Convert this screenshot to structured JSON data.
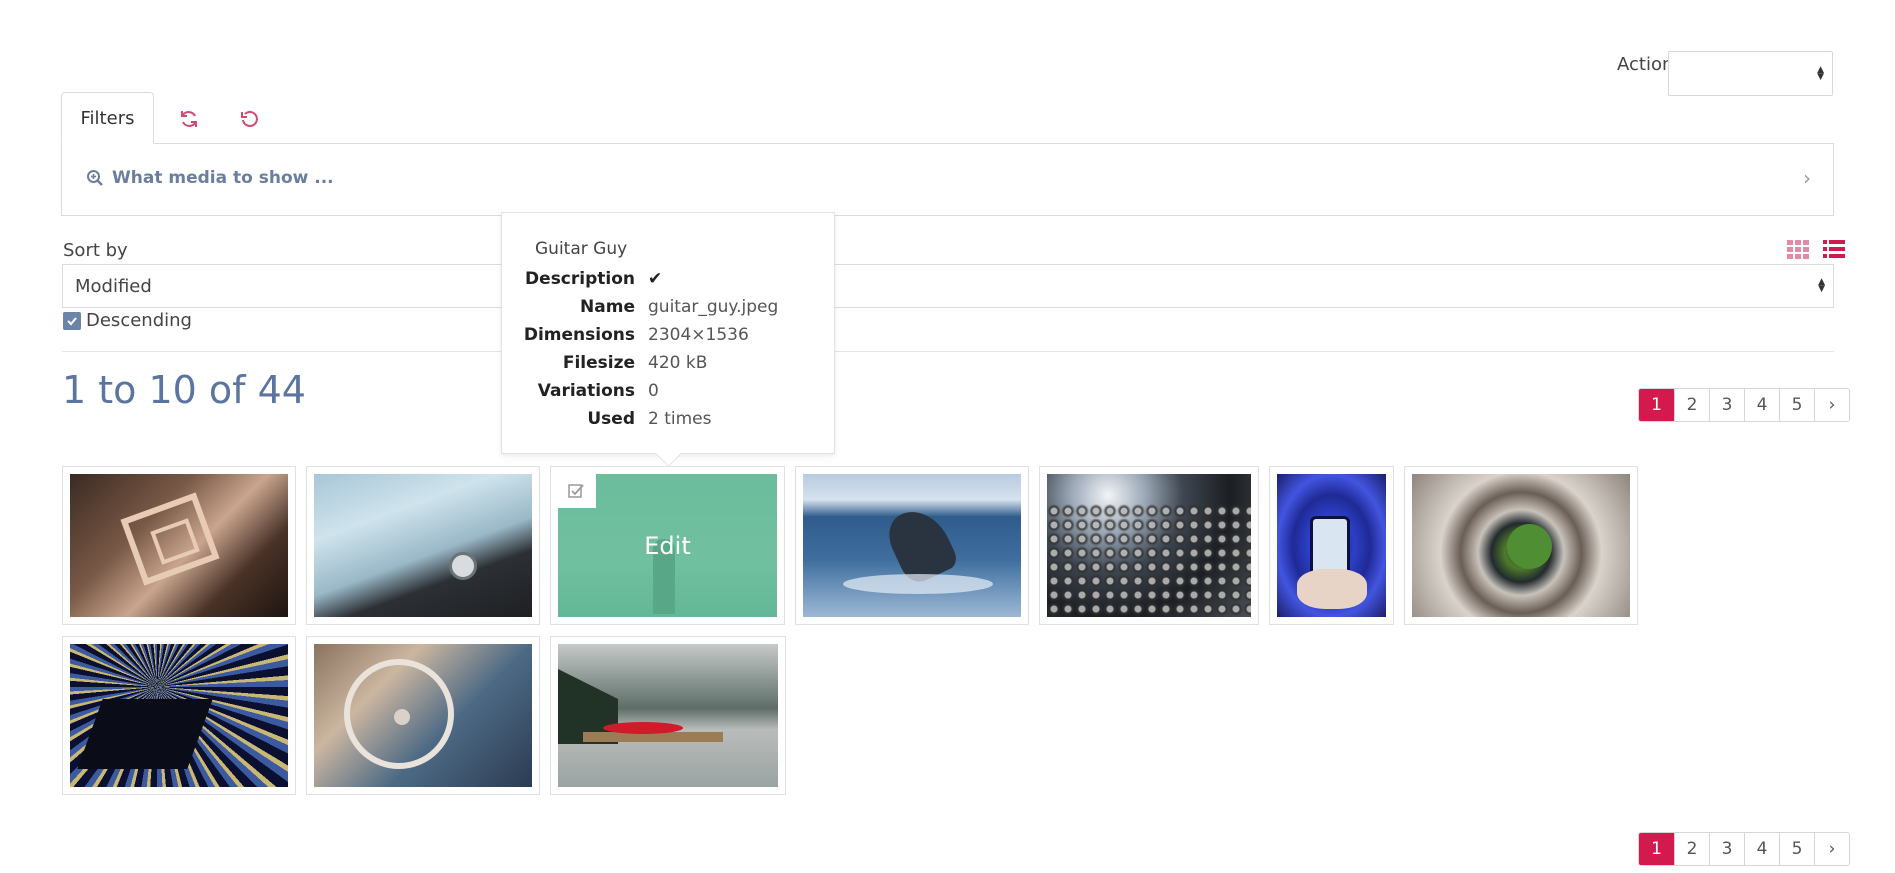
{
  "action": {
    "label": "Action",
    "value": ""
  },
  "tabs": {
    "filters": "Filters"
  },
  "filter_panel": {
    "label": "What media to show ..."
  },
  "sort": {
    "label": "Sort by",
    "value": "Modified",
    "descending_label": "Descending",
    "descending_checked": true
  },
  "result_count": "1 to 10 of 44",
  "pagination": {
    "pages": [
      "1",
      "2",
      "3",
      "4",
      "5"
    ],
    "active": "1",
    "next": "›"
  },
  "thumbnails": [
    {
      "name": "spiral-staircase-dark"
    },
    {
      "name": "blue-car-hood"
    },
    {
      "name": "guitar-guy",
      "overlay": "Edit"
    },
    {
      "name": "whale-breach"
    },
    {
      "name": "building-facade-discs"
    },
    {
      "name": "phone-arches"
    },
    {
      "name": "spiral-stair-garden"
    },
    {
      "name": "light-rays-structure"
    },
    {
      "name": "car-steering-wheel"
    },
    {
      "name": "lake-red-kayak"
    }
  ],
  "tooltip": {
    "title": "Guitar Guy",
    "rows": [
      {
        "key": "Description",
        "value": "✔"
      },
      {
        "key": "Name",
        "value": "guitar_guy.jpeg"
      },
      {
        "key": "Dimensions",
        "value": "2304×1536"
      },
      {
        "key": "Filesize",
        "value": "420 kB"
      },
      {
        "key": "Variations",
        "value": "0"
      },
      {
        "key": "Used",
        "value": "2 times"
      }
    ]
  },
  "colors": {
    "accent": "#d21a4e",
    "link": "#6a7fa0",
    "count": "#5b74a0",
    "overlay": "#5cba94"
  },
  "icons": [
    "refresh-icon",
    "undo-icon",
    "search-zoom-icon",
    "chevron-right-icon",
    "grid-view-icon",
    "list-view-icon",
    "checkbox-icon"
  ]
}
